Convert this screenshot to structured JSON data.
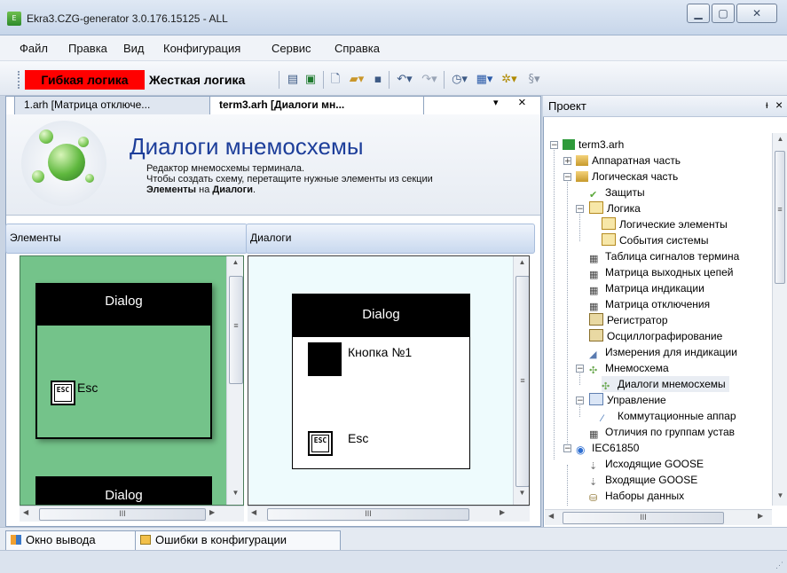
{
  "window": {
    "title": "Ekra3.CZG-generator 3.0.176.15125 - ALL",
    "minimize_icon": "minimize-icon",
    "maximize_icon": "maximize-icon",
    "close_icon": "close-icon"
  },
  "menu": {
    "items": [
      "Файл",
      "Правка",
      "Вид",
      "Конфигурация",
      "Сервис",
      "Справка"
    ]
  },
  "toolbar": {
    "flex_logic": "Гибкая логика",
    "hard_logic": "Жесткая логика",
    "flex_logic_color": "#ff0000"
  },
  "doc_tabs": {
    "tab1": "1.arh [Матрица отключе...",
    "tab2": "term3.arh [Диалоги мн...",
    "dropdown_glyph": "▾",
    "close_glyph": "×"
  },
  "header": {
    "title": "Диалоги мнемосхемы",
    "line1": "Редактор мнемосхемы терминала.",
    "line2": "Чтобы создать схему, перетащите нужные элементы из секции",
    "line3_bold1": "Элементы",
    "line3_mid": " на ",
    "line3_bold2": "Диалоги",
    "line3_end": "."
  },
  "elements_panel": {
    "label": "Элементы",
    "dialog_title": "Dialog",
    "esc_label": "Esc",
    "esc_icon_text": "ESC",
    "partial_dialog": "Dialog",
    "bg_color": "#74c38a"
  },
  "dialogs_panel": {
    "label": "Диалоги",
    "dialog_title": "Dialog",
    "button_label": "Кнопка №1",
    "esc_label": "Esc",
    "esc_icon_text": "ESC"
  },
  "project": {
    "title": "Проект",
    "pin": "ᵼ",
    "close": "×",
    "tree": [
      {
        "label": "term3.arh"
      },
      {
        "label": "Аппаратная часть"
      },
      {
        "label": "Логическая часть"
      },
      {
        "label": "Защиты"
      },
      {
        "label": "Логика"
      },
      {
        "label": "Логические элементы"
      },
      {
        "label": "События системы"
      },
      {
        "label": "Таблица сигналов термина"
      },
      {
        "label": "Матрица выходных цепей"
      },
      {
        "label": "Матрица индикации"
      },
      {
        "label": "Матрица отключения"
      },
      {
        "label": "Регистратор"
      },
      {
        "label": "Осциллографирование"
      },
      {
        "label": "Измерения для индикации"
      },
      {
        "label": "Мнемосхема"
      },
      {
        "label": "Диалоги мнемосхемы"
      },
      {
        "label": "Управление"
      },
      {
        "label": "Коммутационные аппар"
      },
      {
        "label": "Отличия по группам устав"
      },
      {
        "label": "IEC61850"
      },
      {
        "label": "Исходящие GOOSE"
      },
      {
        "label": "Входящие GOOSE"
      },
      {
        "label": "Наборы данных"
      }
    ]
  },
  "bottom_tabs": {
    "output": "Окно вывода",
    "errors": "Ошибки в конфигурации"
  },
  "scroll": {
    "grip": "III",
    "grip_v": "≡"
  }
}
